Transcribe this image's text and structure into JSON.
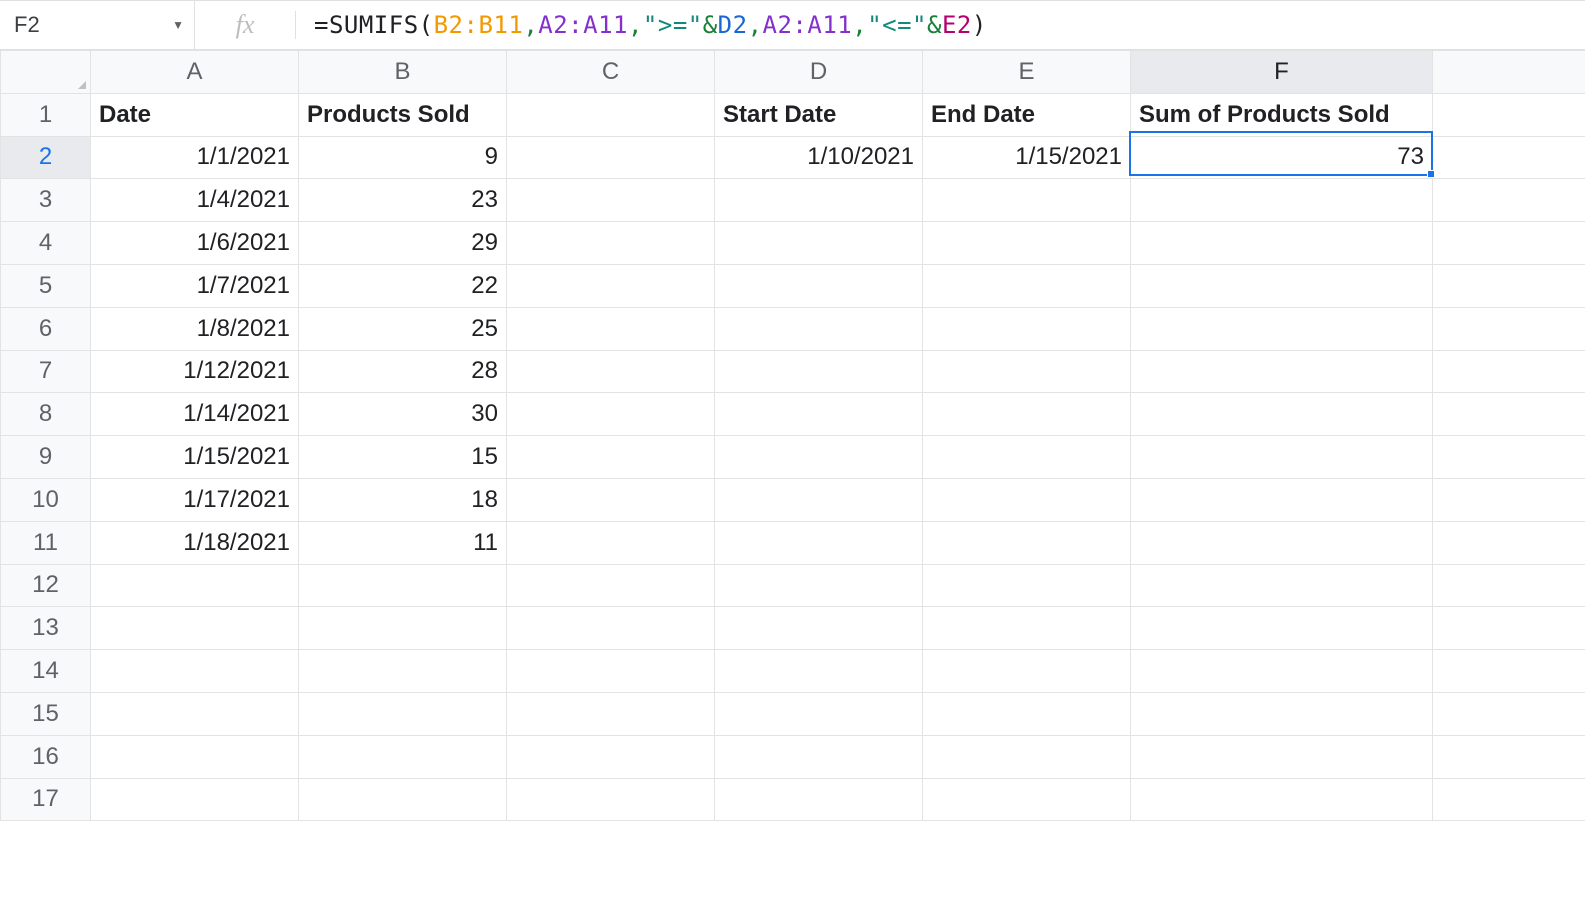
{
  "name_box": "F2",
  "fx_label": "fx",
  "formula_tokens": [
    {
      "t": "=",
      "c": "t-black"
    },
    {
      "t": "SUMIFS",
      "c": "t-black"
    },
    {
      "t": "(",
      "c": "t-black"
    },
    {
      "t": "B2:B11",
      "c": "t-orange"
    },
    {
      "t": ",",
      "c": "t-green"
    },
    {
      "t": "A2:A11",
      "c": "t-purple"
    },
    {
      "t": ",",
      "c": "t-green"
    },
    {
      "t": "\">=\"",
      "c": "t-teal"
    },
    {
      "t": "&",
      "c": "t-green"
    },
    {
      "t": "D2",
      "c": "t-blue"
    },
    {
      "t": ",",
      "c": "t-green"
    },
    {
      "t": "A2:A11",
      "c": "t-purple"
    },
    {
      "t": ",",
      "c": "t-green"
    },
    {
      "t": "\"<=\"",
      "c": "t-teal"
    },
    {
      "t": "&",
      "c": "t-green"
    },
    {
      "t": "E2",
      "c": "t-magenta"
    },
    {
      "t": ")",
      "c": "t-black"
    }
  ],
  "columns": [
    "A",
    "B",
    "C",
    "D",
    "E",
    "F",
    ""
  ],
  "visible_rows": 17,
  "selected_cell": "F2",
  "headers": {
    "A": "Date",
    "B": "Products Sold",
    "D": "Start Date",
    "E": "End Date",
    "F": "Sum of Products Sold"
  },
  "data": {
    "A": [
      "1/1/2021",
      "1/4/2021",
      "1/6/2021",
      "1/7/2021",
      "1/8/2021",
      "1/12/2021",
      "1/14/2021",
      "1/15/2021",
      "1/17/2021",
      "1/18/2021"
    ],
    "B": [
      "9",
      "23",
      "29",
      "22",
      "25",
      "28",
      "30",
      "15",
      "18",
      "11"
    ],
    "D": [
      "1/10/2021"
    ],
    "E": [
      "1/15/2021"
    ],
    "F": [
      "73"
    ]
  },
  "selection": {
    "col_index": 6,
    "row_index": 2
  }
}
